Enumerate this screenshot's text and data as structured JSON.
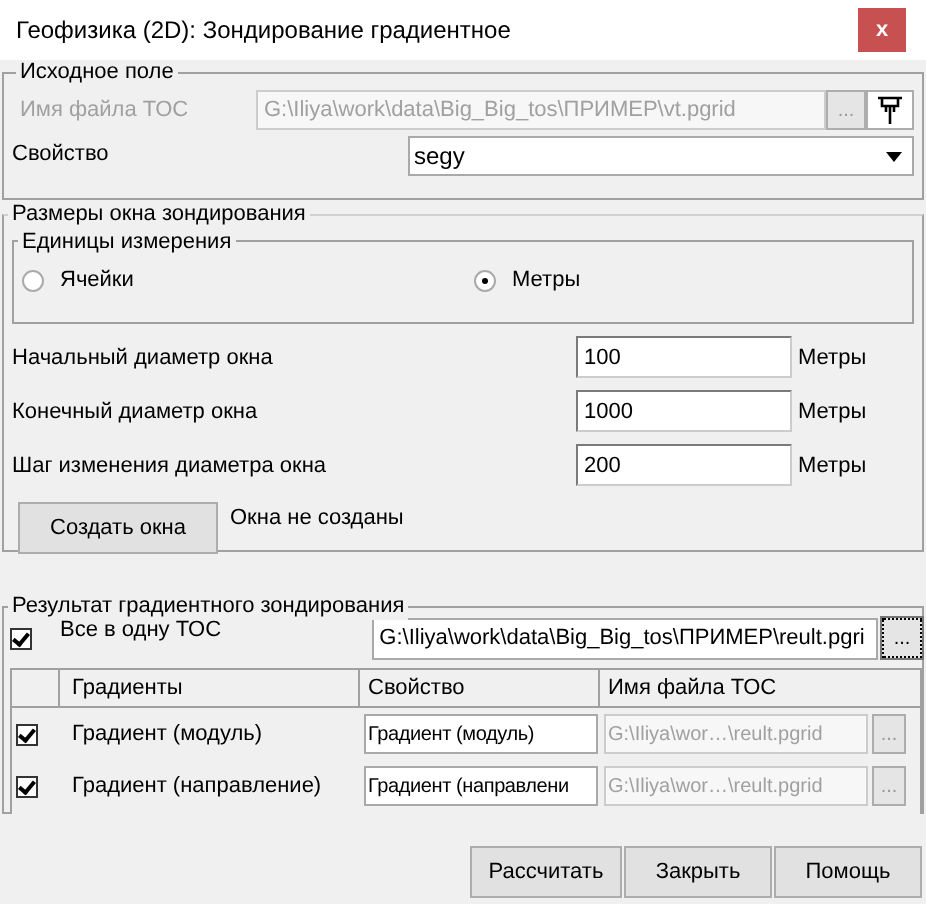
{
  "window": {
    "title": "Геофизика (2D): Зондирование градиентное",
    "close": "x"
  },
  "source": {
    "title": "Исходное поле",
    "file_label": "Имя файла ТОС",
    "file_label_disabled": true,
    "file_value": "G:\\Iliya\\work\\data\\Big_Big_tos\\ПРИМЕР\\vt.pgrid",
    "file_disabled": true,
    "browse": "...",
    "property_label": "Свойство",
    "property_value": "segy"
  },
  "sizes": {
    "title": "Размеры окна зондирования",
    "units_title": "Единицы измерения",
    "units": [
      {
        "label": "Ячейки",
        "selected": false
      },
      {
        "label": "Метры",
        "selected": true
      }
    ],
    "fields": [
      {
        "label": "Начальный диаметр окна",
        "value": "100",
        "unit": "Метры"
      },
      {
        "label": "Конечный диаметр окна",
        "value": "1000",
        "unit": "Метры"
      },
      {
        "label": "Шаг изменения диаметра окна",
        "value": "200",
        "unit": "Метры"
      }
    ],
    "create_button": "Создать окна",
    "status": "Окна не созданы"
  },
  "result": {
    "title": "Результат градиентного зондирования",
    "all_in_one": {
      "label": "Все в одну ТОС",
      "checked": true
    },
    "file_value": "G:\\Iliya\\work\\data\\Big_Big_tos\\ПРИМЕР\\reult.pgri",
    "browse": "...",
    "table": {
      "columns": [
        "Градиенты",
        "Свойство",
        "Имя файла ТОС"
      ],
      "rows": [
        {
          "checked": true,
          "name": "Градиент (модуль)",
          "property": "Градиент (модуль)",
          "file": "G:\\Iliya\\wor…\\reult.pgrid",
          "file_disabled": true,
          "browse": "..."
        },
        {
          "checked": true,
          "name": "Градиент (направление)",
          "property": "Градиент (направлени",
          "file": "G:\\Iliya\\wor…\\reult.pgrid",
          "file_disabled": true,
          "browse": "..."
        }
      ]
    }
  },
  "buttons": [
    "Рассчитать",
    "Закрыть",
    "Помощь"
  ]
}
